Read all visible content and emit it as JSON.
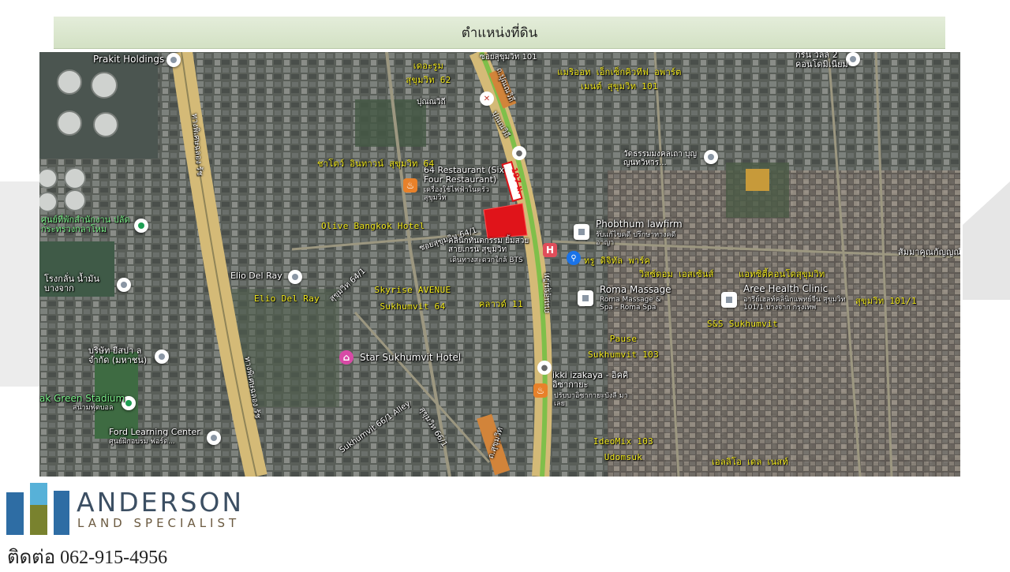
{
  "header": {
    "title": "ตำแหน่งที่ดิน"
  },
  "map": {
    "places": [
      {
        "name": "Prakit Holdings"
      },
      {
        "name": "ศูนย์ที่พักสำนักงาน ปลัดกระทรวงกลาโหม"
      },
      {
        "name": "โรงกลั่น น้ำมัน บางจาก"
      },
      {
        "name": "Elio Del Ray"
      },
      {
        "name": "บริษัท ยีสปา ล จำกัด (มหาชน)"
      },
      {
        "name": "ak Green Stadium",
        "sub": "สนามฟุตบอล"
      },
      {
        "name": "Ford Learning Center",
        "sub": "ศูนย์ฝึกอบรม ฟอร์ด..."
      },
      {
        "name": "64 Restaurant (Six Four Restaurant)",
        "sub": "เครื่องใช้ไฟฟ้าในครัว สุขุมวิท"
      },
      {
        "name": "คลินิกทันตกรรม ยิ้มสวยสายเกรน สุขุมวิท",
        "sub": "เดินทางสะดวกใกล้ BTS"
      },
      {
        "name": "Star Sukhumvit Hotel"
      },
      {
        "name": "Phobthum lawfirm",
        "sub": "รับแก้ไขคดี ปรึกษาทางคดีอาญา"
      },
      {
        "name": "Roma Massage",
        "sub": "Roma Massage & Spa - Roma Spa"
      },
      {
        "name": "Aree Health Clinic",
        "sub": "อารีย์เฮลท์คลินิกแพทย์จีน สุขุมวิท 101/1 บางจาก กรุงเทพ"
      },
      {
        "name": "ikki izakaya - อิคคิ อิซากายะ",
        "sub": "ปรับบาอิซากายะบังลี มาเลย"
      },
      {
        "name": "วัดธรรมมงคลเถา บุญญนทวิหาร..."
      },
      {
        "name": "กรีน วิลล์ 2 คอนโดมิเนียม"
      },
      {
        "name": "สัมมาคุณกัญญณ์"
      },
      {
        "name": "ปุณณวิถี"
      }
    ],
    "projects": [
      {
        "name": "เดอะรูม สุขุมวิท 62"
      },
      {
        "name": "แมริออท เอ็กเซ็กคิวทีฟ อพาร์ต เมนต์ สุขุมวิท 101"
      },
      {
        "name": "ชาโตว์ อินทาวน์ สุขุมวิท 64"
      },
      {
        "name": "Olive Bangkok Hotel"
      },
      {
        "name": "Elio Del Ray"
      },
      {
        "name": "Skyrise AVENUE Sukhumvit 64"
      },
      {
        "name": "คลาวด์ 11"
      },
      {
        "name": "ทรู ดิจิทัล พาร์ค"
      },
      {
        "name": "วิสซ์ดอม เอสเซ้นส์"
      },
      {
        "name": "แอทซิตี้คอนโดสุขุมวิท"
      },
      {
        "name": "สุขุมวิท 101/1"
      },
      {
        "name": "S&S Sukhumvit"
      },
      {
        "name": "Pause Sukhumvit 103"
      },
      {
        "name": "IdeoMix 103 Udomsuk"
      },
      {
        "name": "เอลลิโอ เดล เนสท์"
      }
    ],
    "roads": [
      {
        "name": "ซอยสุขุมวิท 101"
      },
      {
        "name": "ถ.ปุณณวิถี"
      },
      {
        "name": "ปุณณวิถี"
      },
      {
        "name": "197 ม."
      },
      {
        "name": "ซอยสุขุมวิท 64/1"
      },
      {
        "name": "ถนนสุขุมวิท"
      },
      {
        "name": "ทางพิเศษฉลอง รัช"
      },
      {
        "name": "ทางพิเศษฉลอง รัช"
      },
      {
        "name": "ถ.สุขุมวิท"
      },
      {
        "name": "Sukhumvit 66/1 Alley"
      },
      {
        "name": "สุขุมวิท 66/1"
      },
      {
        "name": "สุขุมวิท 64/1"
      }
    ],
    "plot_color": "#e0141a"
  },
  "footer": {
    "brand": "ANDERSON",
    "tagline": "LAND SPECIALIST",
    "contact": "ติดต่อ 062-915-4956"
  },
  "colors": {
    "header_bg": "#dfe9d4",
    "brand_blue": "#3c4f63",
    "brand_brown": "#6b5a40",
    "project_label": "#f3ea1d"
  }
}
